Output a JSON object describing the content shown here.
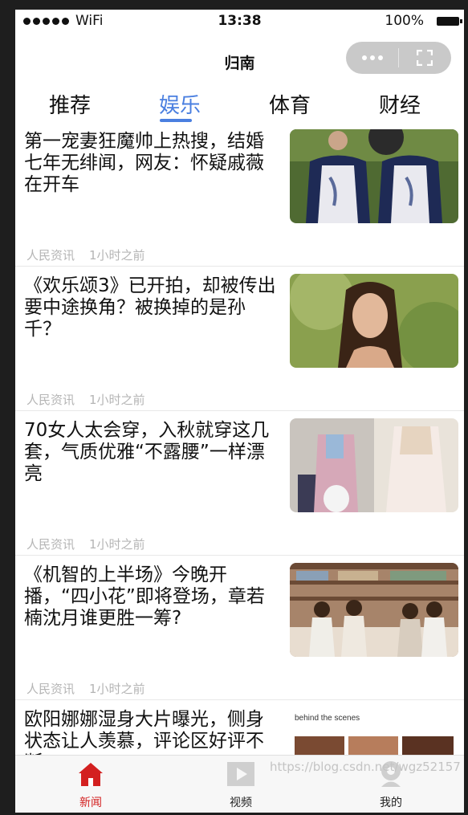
{
  "status_bar": {
    "carrier": "WiFi",
    "time": "13:38",
    "battery": "100%"
  },
  "nav": {
    "title": "归南"
  },
  "tabs": [
    {
      "label": "推荐",
      "active": false
    },
    {
      "label": "娱乐",
      "active": true
    },
    {
      "label": "体育",
      "active": false
    },
    {
      "label": "财经",
      "active": false
    }
  ],
  "news": [
    {
      "title": "第一宠妻狂魔帅上热搜，结婚七年无绯闻，网友：怀疑戚薇在开车",
      "source": "人民资讯",
      "time": "1小时之前"
    },
    {
      "title": "《欢乐颂3》已开拍，却被传出要中途换角？被换掉的是孙千？",
      "source": "人民资讯",
      "time": "1小时之前"
    },
    {
      "title": "70女人太会穿，入秋就穿这几套，气质优雅“不露腰”一样漂亮",
      "source": "人民资讯",
      "time": "1小时之前"
    },
    {
      "title": "《机智的上半场》今晚开播，“四小花”即将登场，章若楠沈月谁更胜一筹?",
      "source": "人民资讯",
      "time": "1小时之前"
    },
    {
      "title": "欧阳娜娜湿身大片曝光，侧身状态让人羡慕，评论区好评不断",
      "thumb_text": "behind the scenes"
    }
  ],
  "tabbar": [
    {
      "label": "新闻",
      "icon": "home-icon",
      "active": true
    },
    {
      "label": "视频",
      "icon": "play-icon",
      "active": false
    },
    {
      "label": "我的",
      "icon": "user-icon",
      "active": false
    }
  ],
  "watermark": "https://blog.csdn.net/wgz52157",
  "colors": {
    "accent": "#4a7fe0",
    "tab_active": "#d32020"
  }
}
